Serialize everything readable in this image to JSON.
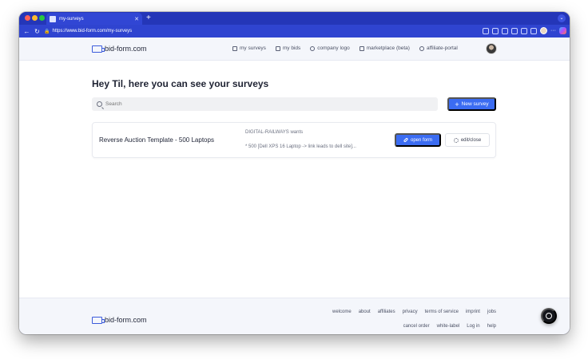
{
  "browser": {
    "tab_title": "my-surveys",
    "new_tab": "+",
    "url": "https://www.bid-form.com/my-surveys"
  },
  "header": {
    "logo_text": "bid-form.com",
    "nav": [
      {
        "label": "my surveys"
      },
      {
        "label": "my bids"
      },
      {
        "label": "company logo"
      },
      {
        "label": "marketplace (beta)"
      },
      {
        "label": "affiliate-portal"
      }
    ]
  },
  "main": {
    "greeting": "Hey Til, here you can see your surveys",
    "search_placeholder": "Search",
    "new_survey_label": "New survey"
  },
  "surveys": [
    {
      "title": "Reverse Auction Template - 500 Laptops",
      "company": "DIGITAL-RAILWAYS wants",
      "detail": "* 500 [Dell XPS 16 Laptop -> link leads to dell site]...",
      "open_label": "open form",
      "edit_label": "edit/close"
    }
  ],
  "footer": {
    "logo_text": "bid-form.com",
    "links_row1": [
      "welcome",
      "about",
      "affiliates",
      "privacy",
      "terms of service",
      "imprint",
      "jobs"
    ],
    "links_row2": [
      "cancel order",
      "white-label",
      "Log in",
      "help"
    ]
  },
  "colors": {
    "primary": "#3b6cf2",
    "browser_chrome": "#2f44d0",
    "header_bg": "#f4f6fb"
  }
}
